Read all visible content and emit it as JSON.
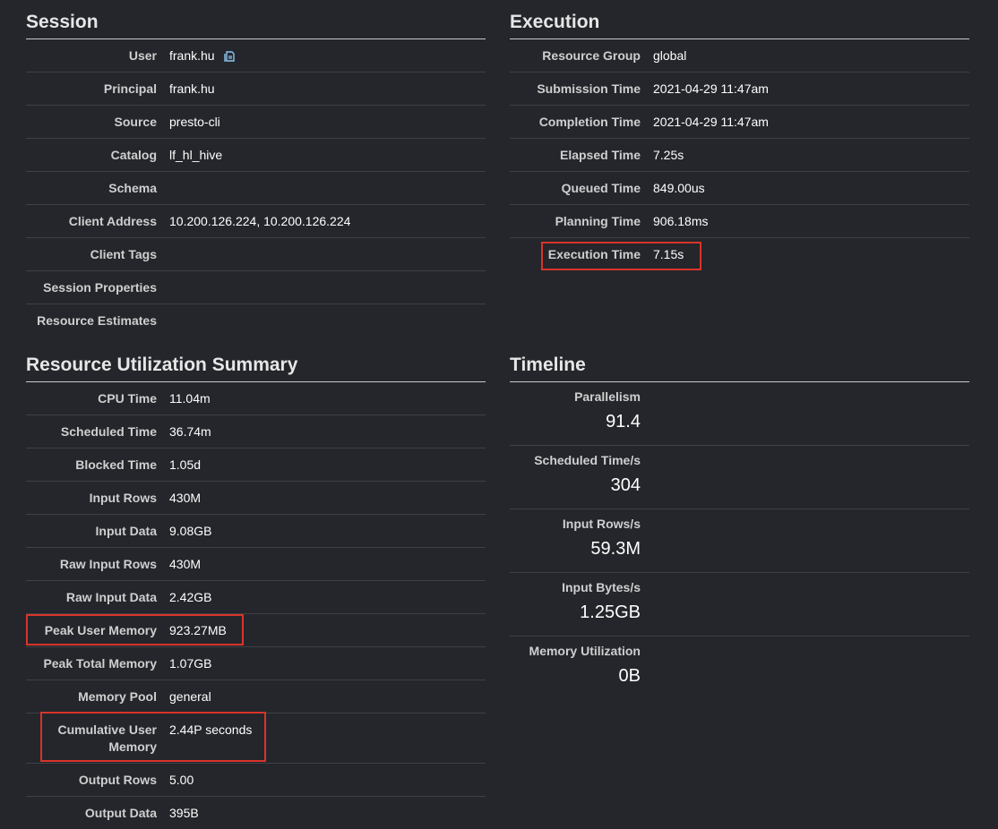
{
  "session": {
    "title": "Session",
    "rows": [
      {
        "label": "User",
        "value": "frank.hu"
      },
      {
        "label": "Principal",
        "value": "frank.hu"
      },
      {
        "label": "Source",
        "value": "presto-cli"
      },
      {
        "label": "Catalog",
        "value": "lf_hl_hive"
      },
      {
        "label": "Schema",
        "value": ""
      },
      {
        "label": "Client Address",
        "value": "10.200.126.224, 10.200.126.224"
      },
      {
        "label": "Client Tags",
        "value": ""
      },
      {
        "label": "Session Properties",
        "value": ""
      },
      {
        "label": "Resource Estimates",
        "value": ""
      }
    ],
    "copy_icon": "clipboard-copy-icon"
  },
  "execution": {
    "title": "Execution",
    "rows": [
      {
        "label": "Resource Group",
        "value": "global"
      },
      {
        "label": "Submission Time",
        "value": "2021-04-29 11:47am"
      },
      {
        "label": "Completion Time",
        "value": "2021-04-29 11:47am"
      },
      {
        "label": "Elapsed Time",
        "value": "7.25s"
      },
      {
        "label": "Queued Time",
        "value": "849.00us"
      },
      {
        "label": "Planning Time",
        "value": "906.18ms"
      },
      {
        "label": "Execution Time",
        "value": "7.15s"
      }
    ]
  },
  "resource": {
    "title": "Resource Utilization Summary",
    "rows": [
      {
        "label": "CPU Time",
        "value": "11.04m"
      },
      {
        "label": "Scheduled Time",
        "value": "36.74m"
      },
      {
        "label": "Blocked Time",
        "value": "1.05d"
      },
      {
        "label": "Input Rows",
        "value": "430M"
      },
      {
        "label": "Input Data",
        "value": "9.08GB"
      },
      {
        "label": "Raw Input Rows",
        "value": "430M"
      },
      {
        "label": "Raw Input Data",
        "value": "2.42GB"
      },
      {
        "label": "Peak User Memory",
        "value": "923.27MB"
      },
      {
        "label": "Peak Total Memory",
        "value": "1.07GB"
      },
      {
        "label": "Memory Pool",
        "value": "general"
      },
      {
        "label": "Cumulative User Memory",
        "value": "2.44P seconds"
      },
      {
        "label": "Output Rows",
        "value": "5.00"
      },
      {
        "label": "Output Data",
        "value": "395B"
      }
    ]
  },
  "timeline": {
    "title": "Timeline",
    "rows": [
      {
        "label": "Parallelism",
        "value": "91.4"
      },
      {
        "label": "Scheduled Time/s",
        "value": "304"
      },
      {
        "label": "Input Rows/s",
        "value": "59.3M"
      },
      {
        "label": "Input Bytes/s",
        "value": "1.25GB"
      },
      {
        "label": "Memory Utilization",
        "value": "0B"
      }
    ]
  },
  "colors": {
    "background": "#24262b",
    "highlight": "#d9342a",
    "copy_icon": "#8fc7f0"
  }
}
